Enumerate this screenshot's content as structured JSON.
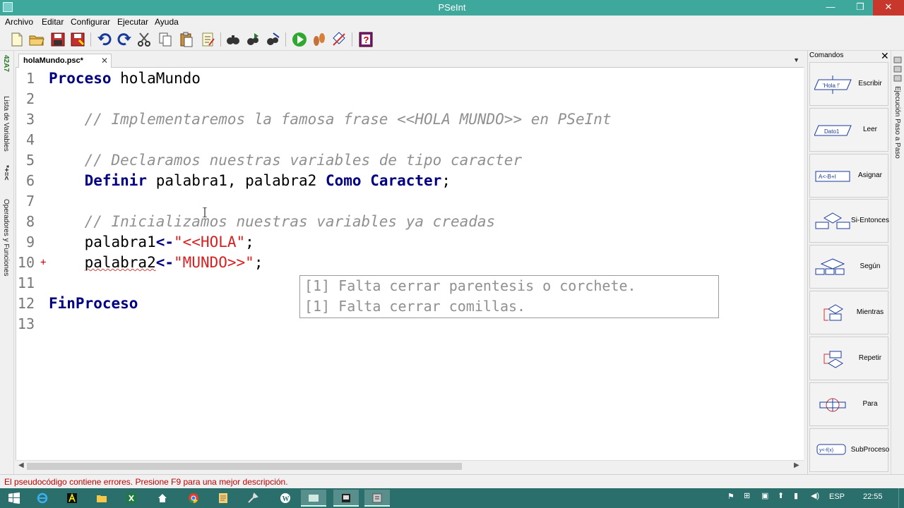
{
  "window": {
    "title": "PSeInt",
    "minimize": "—",
    "restore": "❐",
    "close": "✕"
  },
  "menu": [
    "Archivo",
    "Editar",
    "Configurar",
    "Ejecutar",
    "Ayuda"
  ],
  "left_panel": {
    "variables_label": "Lista de Variables",
    "operators_label": "Operadores y Funciones",
    "var_icon_text": "42A7",
    "op_icon_text": "*+=<"
  },
  "editor": {
    "tab_label": "holaMundo.psc*",
    "tab_close": "✕",
    "lines": [
      {
        "n": "1",
        "parts": [
          {
            "t": "Proceso",
            "c": "kw"
          },
          {
            "t": " holaMundo",
            "c": "id"
          }
        ]
      },
      {
        "n": "2",
        "parts": []
      },
      {
        "n": "3",
        "parts": [
          {
            "t": "    // Implementaremos la famosa frase <<HOLA MUNDO>> en PSeInt",
            "c": "cm"
          }
        ]
      },
      {
        "n": "4",
        "parts": []
      },
      {
        "n": "5",
        "parts": [
          {
            "t": "    // Declaramos nuestras variables de tipo caracter",
            "c": "cm"
          }
        ]
      },
      {
        "n": "6",
        "parts": [
          {
            "t": "    ",
            "c": "id"
          },
          {
            "t": "Definir",
            "c": "kw"
          },
          {
            "t": " palabra1, palabra2 ",
            "c": "id"
          },
          {
            "t": "Como",
            "c": "kw"
          },
          {
            "t": " ",
            "c": "id"
          },
          {
            "t": "Caracter",
            "c": "kw"
          },
          {
            "t": ";",
            "c": "pu"
          }
        ]
      },
      {
        "n": "7",
        "parts": []
      },
      {
        "n": "8",
        "parts": [
          {
            "t": "    // Inicializamos nuestras variables ya creadas",
            "c": "cm"
          }
        ]
      },
      {
        "n": "9",
        "parts": [
          {
            "t": "    palabra1",
            "c": "id"
          },
          {
            "t": "<-",
            "c": "op"
          },
          {
            "t": "\"<<HOLA\"",
            "c": "str"
          },
          {
            "t": ";",
            "c": "pu"
          }
        ]
      },
      {
        "n": "10",
        "mark": "+",
        "parts": [
          {
            "t": "    ",
            "c": "id"
          },
          {
            "t": "palabra2",
            "c": "id squig"
          },
          {
            "t": "<-",
            "c": "op"
          },
          {
            "t": "\"MUNDO>>\"",
            "c": "str"
          },
          {
            "t": ";",
            "c": "pu"
          }
        ]
      },
      {
        "n": "11",
        "parts": []
      },
      {
        "n": "12",
        "parts": [
          {
            "t": "FinProceso",
            "c": "kw"
          }
        ]
      },
      {
        "n": "13",
        "parts": []
      }
    ],
    "errors": [
      "[1] Falta cerrar parentesis o corchete.",
      "[1] Falta cerrar comillas."
    ]
  },
  "commands_panel": {
    "title": "Comandos",
    "close": "✕",
    "items": [
      {
        "label": "Escribir",
        "icon_text": "'Hola !'"
      },
      {
        "label": "Leer",
        "icon_text": "Dato1"
      },
      {
        "label": "Asignar",
        "icon_text": "A<-B+I"
      },
      {
        "label": "Si-Entonces",
        "icon_text": ""
      },
      {
        "label": "Según",
        "icon_text": ""
      },
      {
        "label": "Mientras",
        "icon_text": ""
      },
      {
        "label": "Repetir",
        "icon_text": ""
      },
      {
        "label": "Para",
        "icon_text": ""
      },
      {
        "label": "SubProceso",
        "icon_text": "y<-f(x)"
      }
    ]
  },
  "right_strip": {
    "label": "Ejecución Paso a Paso"
  },
  "status": {
    "message": "El pseudocódigo contiene errores. Presione F9 para una mejor descripción."
  },
  "taskbar": {
    "language": "ESP",
    "time": "22:55"
  },
  "colors": {
    "titlebar": "#3fa89c",
    "keyword": "#000080",
    "comment": "#909090",
    "string": "#d82020",
    "status_error": "#c00000",
    "taskbar": "#2a6f6b"
  }
}
